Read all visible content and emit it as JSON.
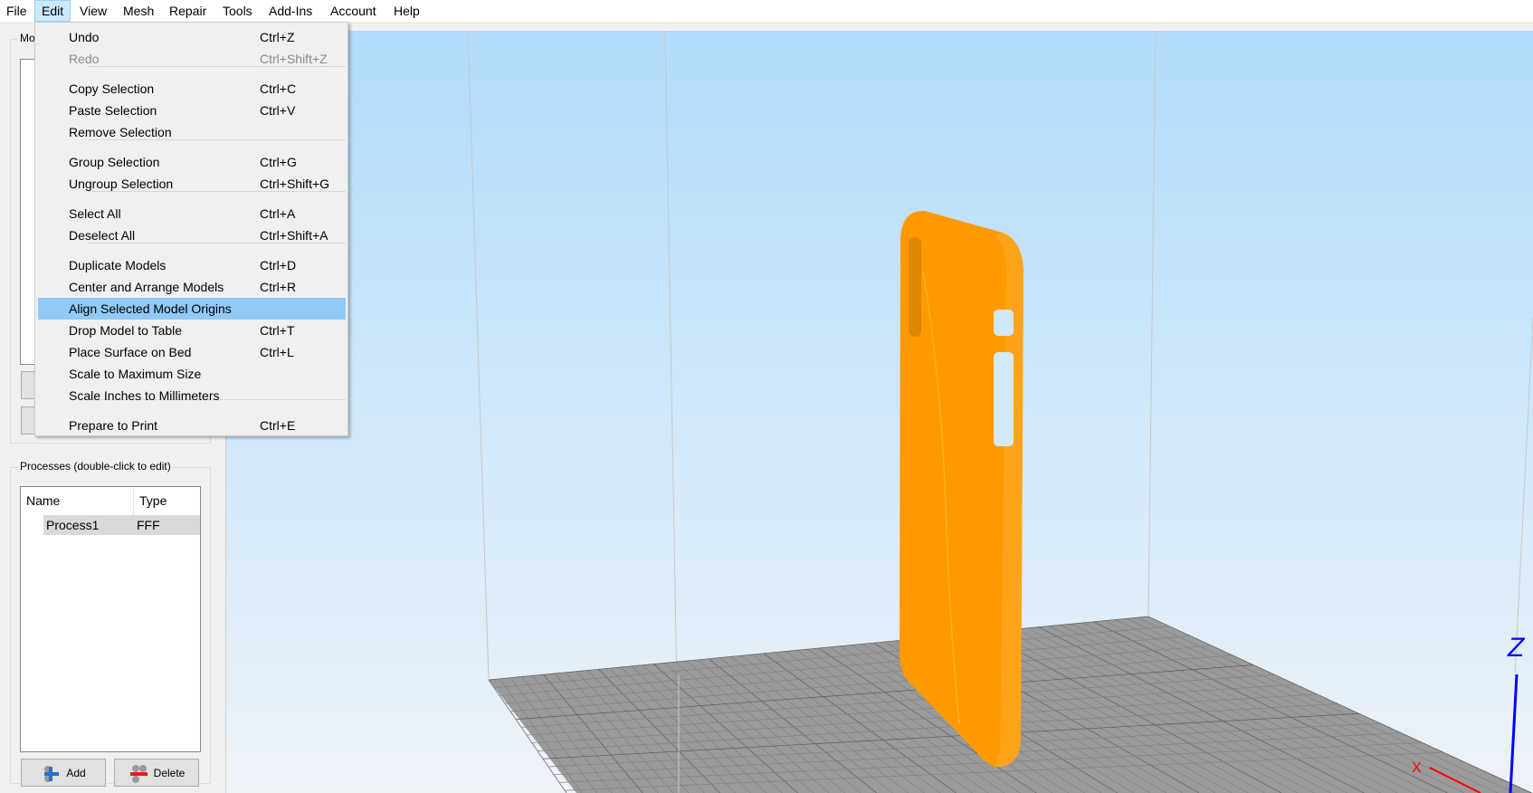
{
  "menubar": [
    "File",
    "Edit",
    "View",
    "Mesh",
    "Repair",
    "Tools",
    "Add-Ins",
    "Account",
    "Help"
  ],
  "edit_menu": {
    "items": [
      {
        "label": "Undo",
        "shortcut": "Ctrl+Z"
      },
      {
        "label": "Redo",
        "shortcut": "Ctrl+Shift+Z",
        "disabled": true
      },
      {
        "label": "Copy Selection",
        "shortcut": "Ctrl+C"
      },
      {
        "label": "Paste Selection",
        "shortcut": "Ctrl+V"
      },
      {
        "label": "Remove Selection",
        "shortcut": ""
      },
      {
        "label": "Group Selection",
        "shortcut": "Ctrl+G"
      },
      {
        "label": "Ungroup Selection",
        "shortcut": "Ctrl+Shift+G"
      },
      {
        "label": "Select All",
        "shortcut": "Ctrl+A"
      },
      {
        "label": "Deselect All",
        "shortcut": "Ctrl+Shift+A"
      },
      {
        "label": "Duplicate Models",
        "shortcut": "Ctrl+D"
      },
      {
        "label": "Center and Arrange Models",
        "shortcut": "Ctrl+R"
      },
      {
        "label": "Align Selected Model Origins",
        "shortcut": "",
        "highlighted": true
      },
      {
        "label": "Drop Model to Table",
        "shortcut": "Ctrl+T"
      },
      {
        "label": "Place Surface on Bed",
        "shortcut": "Ctrl+L"
      },
      {
        "label": "Scale to Maximum Size",
        "shortcut": ""
      },
      {
        "label": "Scale Inches to Millimeters",
        "shortcut": ""
      },
      {
        "label": "Prepare to Print",
        "shortcut": "Ctrl+E"
      }
    ]
  },
  "models_panel": {
    "label": "Mo"
  },
  "processes_panel": {
    "label": "Processes (double-click to edit)",
    "columns": [
      "Name",
      "Type"
    ],
    "rows": [
      {
        "name": "Process1",
        "type": "FFF"
      }
    ],
    "add_label": "Add",
    "delete_label": "Delete"
  },
  "viewport": {
    "axis_z": "Z",
    "axis_x": "X",
    "model_color": "#ff9900",
    "bed_color": "#9a9a9a"
  }
}
